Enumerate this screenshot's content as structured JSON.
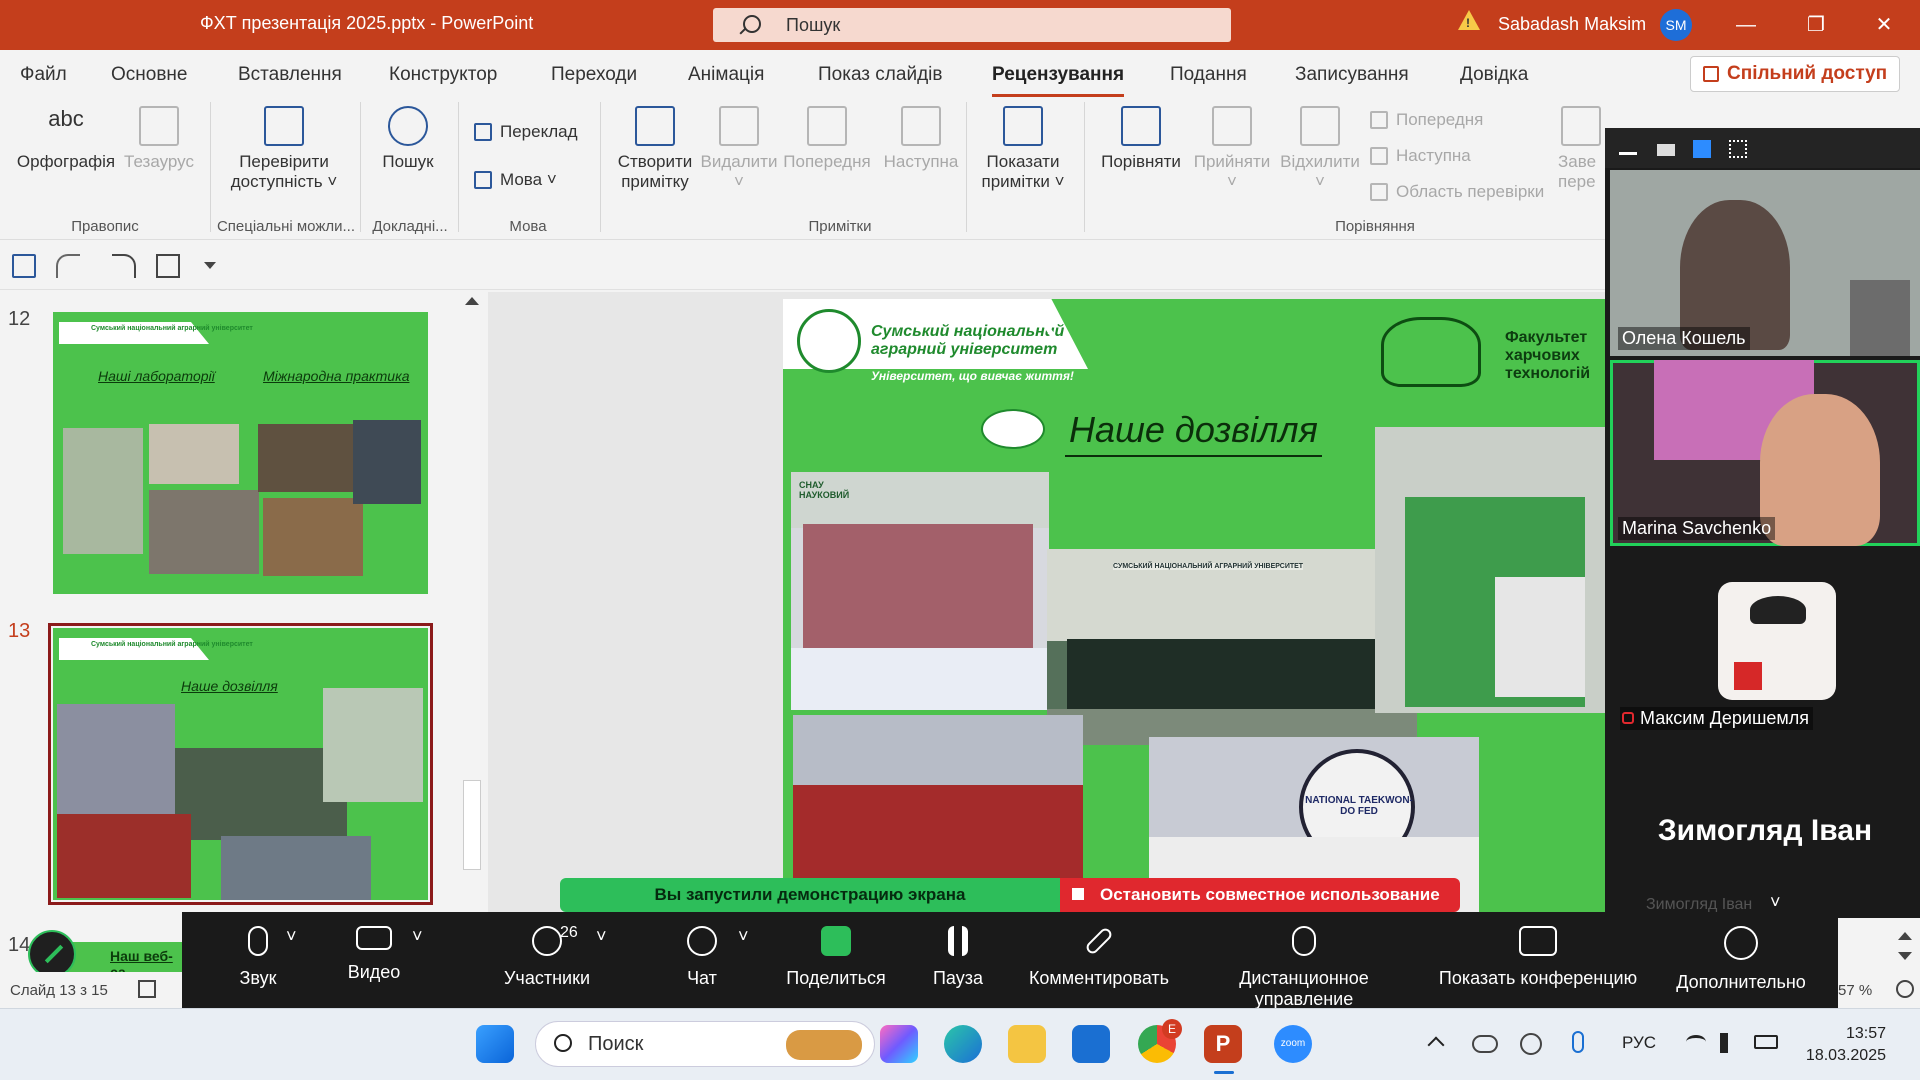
{
  "titlebar": {
    "doc_title": "ФХТ презентація 2025.pptx  -  PowerPoint",
    "search_placeholder": "Пошук",
    "user_name": "Sabadash Maksim",
    "user_initials": "SM",
    "warn_glyph": "!",
    "minimize": "—",
    "restore": "❐",
    "close": "✕"
  },
  "menu": {
    "tabs": [
      "Файл",
      "Основне",
      "Вставлення",
      "Конструктор",
      "Переходи",
      "Анімація",
      "Показ слайдів",
      "Рецензування",
      "Подання",
      "Записування",
      "Довідка"
    ],
    "share": "Спільний доступ"
  },
  "ribbon": {
    "spelling": "Орфографія",
    "spelling_icon_text": "abc",
    "thesaurus": "Тезаурус",
    "check_access_1": "Перевірити",
    "check_access_2": "доступність ˅",
    "search": "Пошук",
    "translate": "Переклад",
    "language": "Мова ˅",
    "new_comment_1": "Створити",
    "new_comment_2": "примітку",
    "delete": "Видалити",
    "delete_caret": "˅",
    "previous": "Попередня",
    "next": "Наступна",
    "show_comments_1": "Показати",
    "show_comments_2": "примітки ˅",
    "compare": "Порівняти",
    "accept": "Прийняти",
    "accept_caret": "˅",
    "reject": "Відхилити",
    "reject_caret": "˅",
    "cmp_prev": "Попередня",
    "cmp_next": "Наступна",
    "review_area": "Область перевірки",
    "end_1": "Заве",
    "end_2": "пере",
    "groups": {
      "proofing": "Правопис",
      "accessibility": "Спеціальні можли...",
      "insights": "Докладні...",
      "language": "Мова",
      "comments": "Примітки",
      "compare": "Порівняння"
    }
  },
  "slides": {
    "thumb12_num": "12",
    "thumb13_num": "13",
    "thumb14_num": "14",
    "thumb12_lab": "Наші лабораторії",
    "thumb12_intl": "Міжнародна практика",
    "thumb13_title": "Наше дозвілля",
    "thumb14_title": "Наш веб-са",
    "thumb_uni": "Сумський національний аграрний університет",
    "thumb_fac": "Факультет харчових технологій"
  },
  "slide": {
    "uni_line1": "Сумський національний",
    "uni_line2": "аграрний університет",
    "motto": "Університет, що вивчає життя!",
    "fac_line1": "Факультет",
    "fac_line2": "харчових",
    "fac_line3": "технологій",
    "title": "Наше дозвілля",
    "photo_text_1": "СНАУ НАУКОВИЙ",
    "photo_text_2": "СУМСЬКИЙ НАЦІОНАЛЬНИЙ АГРАРНИЙ УНІВЕРСИТЕТ",
    "photo_text_3": "NATIONAL TAEKWON-DO FED"
  },
  "status": {
    "slide_counter": "Слайд 13 з 15",
    "zoom": "57 %"
  },
  "zoom_share": {
    "started": "Вы запустили демонстрацию экрана",
    "stop": "Остановить совместное использование"
  },
  "participants": {
    "p1": "Олена Кошель",
    "p2": "Marina Savchenko",
    "p3": "Максим Деришемля",
    "p4": "Зимогляд Іван",
    "p4_small": "Зимогляд Іван"
  },
  "zoom_toolbar": {
    "audio": "Звук",
    "video": "Видео",
    "participants": "Участники",
    "participants_count": "26",
    "chat": "Чат",
    "share": "Поделиться",
    "pause": "Пауза",
    "annotate": "Комментировать",
    "remote": "Дистанционное управление",
    "show_conf": "Показать конференцию",
    "more": "Дополнительно",
    "caret": "˅"
  },
  "taskbar": {
    "search": "Поиск",
    "lang": "РУС",
    "time": "13:57",
    "date": "18.03.2025",
    "chrome_badge": "E",
    "powerpoint_letter": "P",
    "zoom_label": "zoom"
  },
  "colors": {
    "ppt_accent": "#c43e1c",
    "slide_green": "#4cc24c",
    "zoom_green": "#2dbe5a",
    "zoom_red": "#e0282e"
  }
}
